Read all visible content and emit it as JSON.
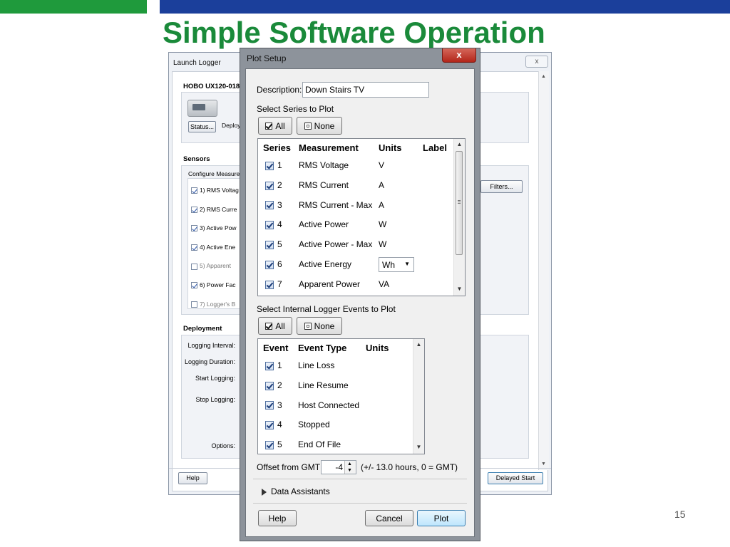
{
  "slide": {
    "title": "Simple Software Operation",
    "page_number": "15",
    "colors": {
      "green": "#1f9a3c",
      "blue": "#1b3f9b",
      "title": "#1a8a3a"
    }
  },
  "launch_logger": {
    "title": "Launch Logger",
    "close": "x",
    "device": "HOBO UX120-018",
    "status_button": "Status...",
    "deploy_text": "Deploy",
    "sensors_label": "Sensors",
    "configure_label": "Configure Measure",
    "filters_button": "Filters...",
    "sensors": [
      {
        "text": "1)  RMS Voltag",
        "checked": true,
        "dim": false
      },
      {
        "text": "2)  RMS Curre",
        "checked": true,
        "dim": false
      },
      {
        "text": "3)  Active Pow",
        "checked": true,
        "dim": false
      },
      {
        "text": "4)  Active Ene",
        "checked": true,
        "dim": false
      },
      {
        "text": "5)  Apparent",
        "checked": false,
        "dim": true
      },
      {
        "text": "6)  Power Fac",
        "checked": true,
        "dim": false
      },
      {
        "text": "7)  Logger's B",
        "checked": false,
        "dim": true
      }
    ],
    "deployment_label": "Deployment",
    "logging_interval": "Logging Interval:",
    "logging_duration": "Logging Duration:",
    "start_logging": "Start Logging:",
    "stop_logging": "Stop Logging:",
    "options": "Options:",
    "help_button": "Help",
    "delayed_start_button": "Delayed Start"
  },
  "plot_setup": {
    "title": "Plot Setup",
    "close": "x",
    "description_label": "Description:",
    "description_value": "Down Stairs TV",
    "select_series_label": "Select Series to Plot",
    "all_button": "All",
    "none_button": "None",
    "series_headers": {
      "series": "Series",
      "measurement": "Measurement",
      "units": "Units",
      "label": "Label"
    },
    "series": [
      {
        "num": "1",
        "measurement": "RMS Voltage",
        "units": "V",
        "checked": true,
        "dropdown": false
      },
      {
        "num": "2",
        "measurement": "RMS Current",
        "units": "A",
        "checked": true,
        "dropdown": false
      },
      {
        "num": "3",
        "measurement": "RMS Current - Max",
        "units": "A",
        "checked": true,
        "dropdown": false
      },
      {
        "num": "4",
        "measurement": "Active Power",
        "units": "W",
        "checked": true,
        "dropdown": false
      },
      {
        "num": "5",
        "measurement": "Active Power - Max",
        "units": "W",
        "checked": true,
        "dropdown": false
      },
      {
        "num": "6",
        "measurement": "Active Energy",
        "units": "Wh",
        "checked": true,
        "dropdown": true
      },
      {
        "num": "7",
        "measurement": "Apparent Power",
        "units": "VA",
        "checked": true,
        "dropdown": false
      }
    ],
    "select_events_label": "Select Internal Logger Events to Plot",
    "event_headers": {
      "event": "Event",
      "event_type": "Event Type",
      "units": "Units"
    },
    "events": [
      {
        "num": "1",
        "type": "Line Loss",
        "checked": true
      },
      {
        "num": "2",
        "type": "Line Resume",
        "checked": true
      },
      {
        "num": "3",
        "type": "Host Connected",
        "checked": true
      },
      {
        "num": "4",
        "type": "Stopped",
        "checked": true
      },
      {
        "num": "5",
        "type": "End Of File",
        "checked": true
      }
    ],
    "offset_label": "Offset from GMT",
    "offset_value": "-4",
    "offset_hint": "(+/- 13.0 hours, 0 = GMT)",
    "data_assistants": "Data Assistants",
    "help_button": "Help",
    "cancel_button": "Cancel",
    "plot_button": "Plot"
  }
}
